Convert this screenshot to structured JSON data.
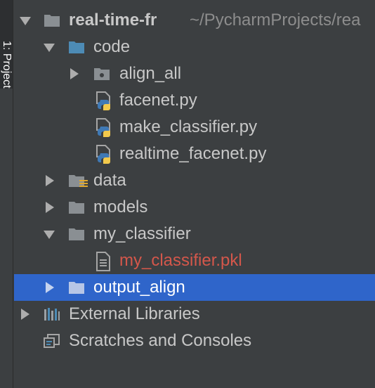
{
  "sidebar": {
    "tab_label": "1: Project"
  },
  "tree": {
    "root": {
      "name": "real-time-fr",
      "path": "~/PycharmProjects/rea"
    },
    "code": {
      "name": "code"
    },
    "align_all": {
      "name": "align_all"
    },
    "facenet": {
      "name": "facenet.py"
    },
    "make_classifier": {
      "name": "make_classifier.py"
    },
    "realtime_facenet": {
      "name": "realtime_facenet.py"
    },
    "data": {
      "name": "data"
    },
    "models": {
      "name": "models"
    },
    "my_classifier": {
      "name": "my_classifier"
    },
    "my_classifier_pkl": {
      "name": "my_classifier.pkl",
      "color": "#d4574b"
    },
    "output_align": {
      "name": "output_align",
      "selected": true
    },
    "external_libraries": {
      "name": "External Libraries"
    },
    "scratches": {
      "name": "Scratches and Consoles"
    }
  },
  "colors": {
    "background": "#3c3f41",
    "selection": "#2f65ca",
    "folder": "#8a8f93",
    "folder_source": "#4d8bb5"
  }
}
